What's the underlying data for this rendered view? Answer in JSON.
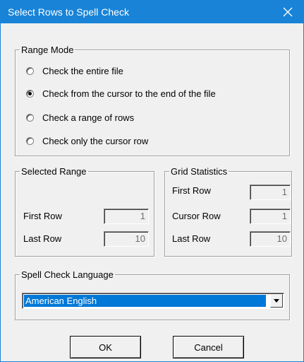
{
  "window": {
    "title": "Select Rows to Spell Check",
    "accent_color": "#1883d7"
  },
  "range_mode": {
    "title": "Range Mode",
    "options": [
      {
        "label": "Check the entire file",
        "checked": false
      },
      {
        "label": "Check from the cursor to the end of the file",
        "checked": true
      },
      {
        "label": "Check a range of rows",
        "checked": false
      },
      {
        "label": "Check only the cursor row",
        "checked": false
      }
    ]
  },
  "selected_range": {
    "title": "Selected Range",
    "first_row_label": "First Row",
    "first_row_value": "1",
    "last_row_label": "Last Row",
    "last_row_value": "10"
  },
  "grid_statistics": {
    "title": "Grid Statistics",
    "first_row_label": "First Row",
    "first_row_value": "1",
    "cursor_row_label": "Cursor Row",
    "cursor_row_value": "1",
    "last_row_label": "Last Row",
    "last_row_value": "10"
  },
  "language": {
    "title": "Spell Check Language",
    "selected": "American English",
    "selection_color": "#0078d7"
  },
  "buttons": {
    "ok": "OK",
    "cancel": "Cancel"
  },
  "icons": {
    "close": "close-icon",
    "dropdown": "chevron-down-icon"
  }
}
